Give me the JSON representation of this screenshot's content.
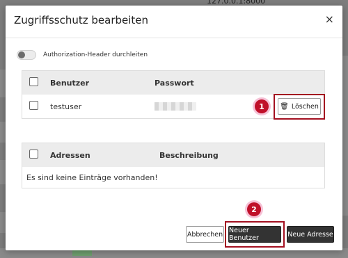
{
  "background": {
    "ip_text": "127.0.0.1:8000"
  },
  "dialog": {
    "title": "Zugriffsschutz bearbeiten",
    "close_symbol": "×",
    "toggle_label": "Authorization-Header durchleiten",
    "users_table": {
      "headers": [
        "Benutzer",
        "Passwort"
      ],
      "rows": [
        {
          "user": "testuser",
          "delete_label": "Löschen"
        }
      ]
    },
    "address_table": {
      "headers": [
        "Adressen",
        "Beschreibung"
      ],
      "empty_message": "Es sind keine Einträge vorhanden!"
    },
    "buttons": {
      "cancel": "Abbrechen",
      "new_user": "Neuer Benutzer",
      "new_address": "Neue Adresse"
    },
    "markers": [
      "1",
      "2"
    ]
  },
  "colors": {
    "marker": "#c0102a",
    "highlight_border": "#a31020",
    "dark_button": "#333333"
  }
}
